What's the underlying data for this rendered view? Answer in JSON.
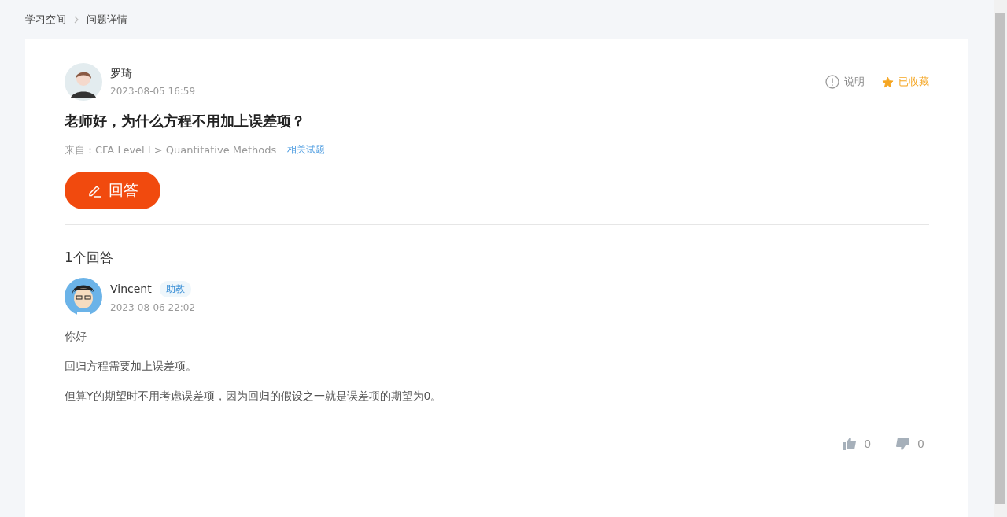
{
  "breadcrumb": [
    "学习空间",
    "问题详情"
  ],
  "question": {
    "author": "罗琦",
    "time": "2023-08-05 16:59",
    "title": "老师好，为什么方程不用加上误差项？",
    "source": "来自：CFA Level I > Quantitative Methods",
    "related_link": "相关试题",
    "explain_label": "说明",
    "favorite_label": "已收藏",
    "favorited": true,
    "answer_button": "回答"
  },
  "answers_count": "1个回答",
  "answers": [
    {
      "author": "Vincent",
      "badge": "助教",
      "time": "2023-08-06 22:02",
      "paragraphs": [
        "你好",
        "回归方程需要加上误差项。",
        "但算Y的期望时不用考虑误差项，因为回归的假设之一就是误差项的期望为0。"
      ],
      "likes": "0",
      "dislikes": "0"
    }
  ]
}
